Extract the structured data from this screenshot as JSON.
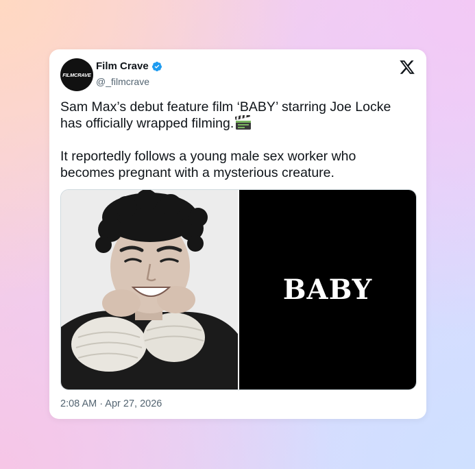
{
  "tweet": {
    "avatar_text": "FILMCRAVE",
    "display_name": "Film Crave",
    "handle": "@_filmcrave",
    "paragraph1": "Sam Max’s debut feature film ‘BABY’ starring Joe Locke has officially wrapped filming.",
    "paragraph2": "It reportedly follows a young male sex worker who becomes pregnant with a mysterious creature.",
    "poster_title": "BABY",
    "timestamp": "2:08 AM · Apr 27, 2026"
  },
  "icons": {
    "verified": "verified-badge-icon",
    "platform": "x-logo-icon",
    "emoji": "clapper-board-icon"
  },
  "colors": {
    "verified_blue": "#1d9bf0",
    "text": "#0f1419",
    "muted": "#536471"
  }
}
